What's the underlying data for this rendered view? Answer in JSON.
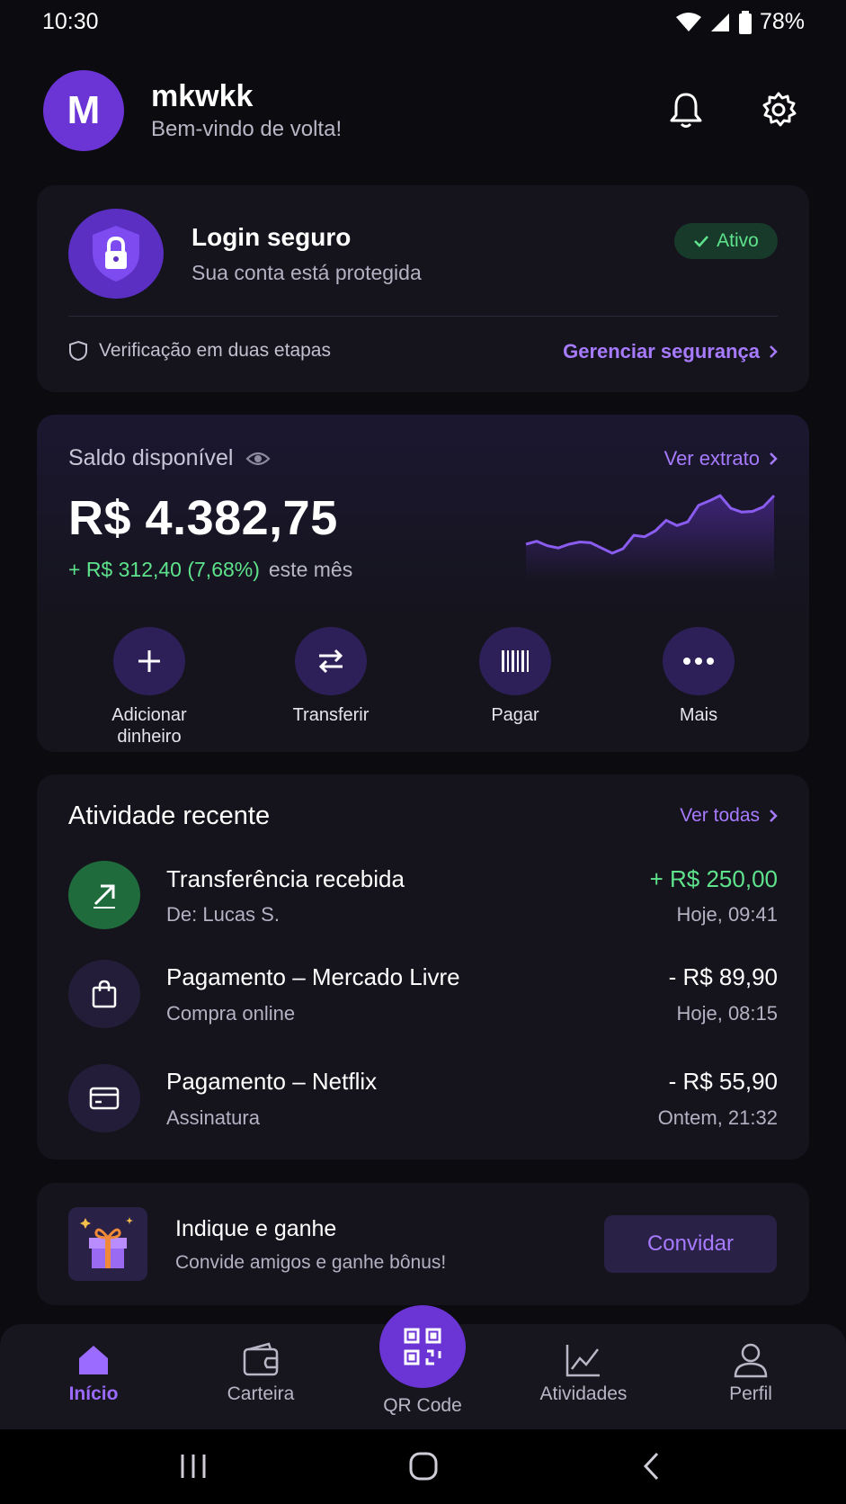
{
  "status_bar": {
    "time": "10:30",
    "battery": "78%"
  },
  "header": {
    "avatar_letter": "M",
    "username": "mkwkk",
    "welcome": "Bem-vindo de volta!"
  },
  "security": {
    "title": "Login seguro",
    "subtitle": "Sua conta está protegida",
    "badge": "Ativo",
    "two_factor": "Verificação em duas etapas",
    "manage_link": "Gerenciar segurança"
  },
  "balance": {
    "label": "Saldo disponível",
    "statement_link": "Ver extrato",
    "amount": "R$ 4.382,75",
    "delta": "+ R$ 312,40 (7,68%)",
    "delta_suffix": "este mês",
    "trend": [
      30,
      34,
      28,
      25,
      30,
      33,
      32,
      25,
      18,
      24,
      42,
      40,
      48,
      62,
      55,
      60,
      82,
      88,
      95,
      78,
      73,
      74,
      80,
      95
    ]
  },
  "actions": [
    {
      "line1": "Adicionar",
      "line2": "dinheiro",
      "icon": "plus-icon"
    },
    {
      "line1": "Transferir",
      "line2": "",
      "icon": "transfer-icon"
    },
    {
      "line1": "Pagar",
      "line2": "",
      "icon": "barcode-icon"
    },
    {
      "line1": "Mais",
      "line2": "",
      "icon": "more-icon"
    }
  ],
  "activity": {
    "title": "Atividade recente",
    "see_all": "Ver todas",
    "items": [
      {
        "title": "Transferência recebida",
        "subtitle": "De: Lucas S.",
        "amount": "+ R$ 250,00",
        "time": "Hoje, 09:41",
        "icon": "arrow-up-right-icon",
        "positive": true
      },
      {
        "title": "Pagamento – Mercado Livre",
        "subtitle": "Compra online",
        "amount": "- R$ 89,90",
        "time": "Hoje, 08:15",
        "icon": "shopping-bag-icon",
        "positive": false
      },
      {
        "title": "Pagamento – Netflix",
        "subtitle": "Assinatura",
        "amount": "- R$ 55,90",
        "time": "Ontem, 21:32",
        "icon": "credit-card-icon",
        "positive": false
      }
    ]
  },
  "referral": {
    "title": "Indique e ganhe",
    "subtitle": "Convide amigos e ganhe bônus!",
    "button": "Convidar"
  },
  "bottom_nav": {
    "home": "Início",
    "wallet": "Carteira",
    "qr": "QR Code",
    "activity": "Atividades",
    "profile": "Perfil"
  },
  "colors": {
    "accent": "#a77bff",
    "brand": "#6b35d6",
    "positive": "#5ee38c"
  }
}
